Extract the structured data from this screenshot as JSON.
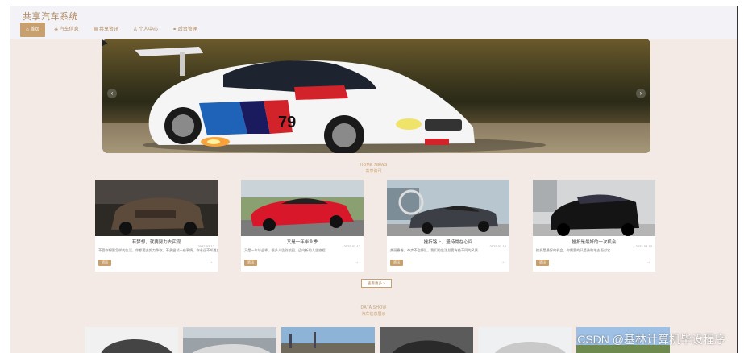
{
  "header": {
    "site_title": "共享汽车系统",
    "nav": [
      {
        "label": "首页",
        "icon": "home-icon",
        "active": true
      },
      {
        "label": "汽车信息",
        "icon": "car-icon",
        "active": false
      },
      {
        "label": "共享资讯",
        "icon": "news-icon",
        "active": false
      },
      {
        "label": "个人中心",
        "icon": "user-icon",
        "active": false
      },
      {
        "label": "后台管理",
        "icon": "link-icon",
        "active": false
      }
    ]
  },
  "banner": {
    "prev_label": "‹",
    "next_label": "›"
  },
  "news_section": {
    "title_en": "HOME NEWS",
    "title_cn": "共享资讯",
    "cards": [
      {
        "title": "有梦想，就要努力去实现",
        "date": "2022-03-12",
        "desc": "不管你想要怎样的生活，你都要去努力争取，不多尝试一些事情，你永远不知道自己有多大的潜力...",
        "tag": "资讯"
      },
      {
        "title": "又是一年毕业季",
        "date": "2022-03-12",
        "desc": "又是一年毕业季，很多人告别校园，迈向新的人生旅程...",
        "tag": "资讯"
      },
      {
        "title": "挫折路上，坚持常在心间",
        "date": "2022-03-12",
        "desc": "美丽春香，夺步不会掉队，我们的生活总要有些不同的风景...",
        "tag": "资讯"
      },
      {
        "title": "挫折是最好的一次机会",
        "date": "2022-03-12",
        "desc": "挫折是最好的机会，你需要的只是勇敢地去面对它...",
        "tag": "资讯"
      }
    ],
    "more_label": "查看更多 >"
  },
  "data_section": {
    "title_en": "DATA SHOW",
    "title_cn": "汽车信息展示"
  },
  "watermark": "CSDN @基林计算机毕设程序",
  "colors": {
    "accent": "#c8a06e",
    "page_bg": "#f3e9e5",
    "header_bg": "#f3f2f6"
  }
}
